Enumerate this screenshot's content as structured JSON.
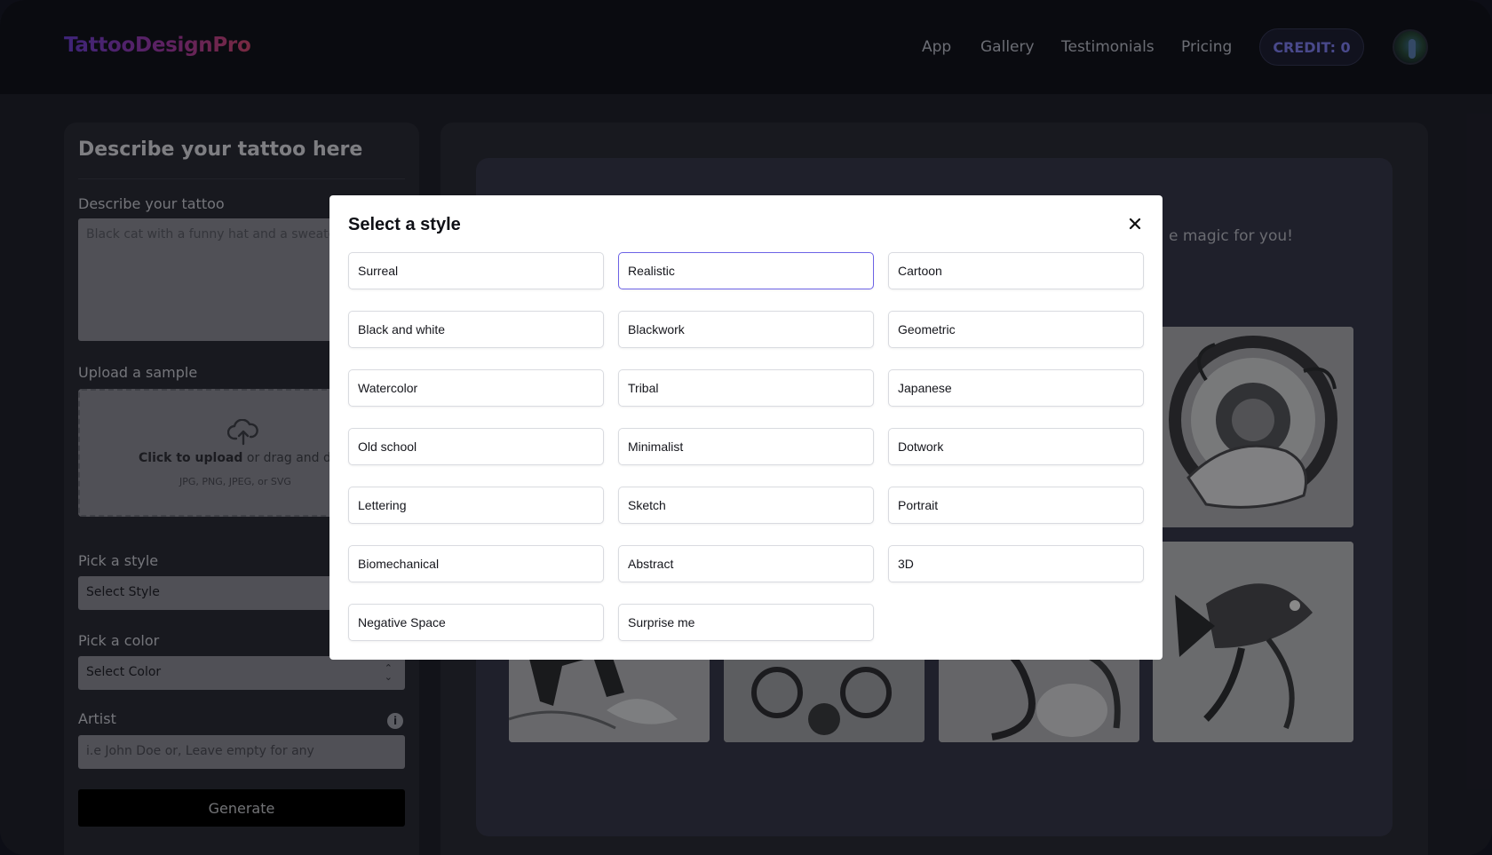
{
  "header": {
    "logo": "TattooDesignPro",
    "nav": [
      "App",
      "Gallery",
      "Testimonials",
      "Pricing"
    ],
    "credit": "CREDIT: 0"
  },
  "form": {
    "title": "Describe your tattoo here",
    "describe_label": "Describe your tattoo",
    "describe_value": "Black cat with a funny hat and a sweater",
    "upload_label": "Upload a sample",
    "upload_click": "Click to upload",
    "upload_drag": " or drag and drop",
    "upload_types": "JPG, PNG, JPEG, or SVG",
    "style_label": "Pick a style",
    "style_value": "Select Style",
    "color_label": "Pick a color",
    "color_value": "Select Color",
    "artist_label": "Artist",
    "artist_placeholder": "i.e John Doe or, Leave empty for any",
    "generate": "Generate"
  },
  "preview": {
    "message": "e magic for you!"
  },
  "modal": {
    "title": "Select a style",
    "selected": "Realistic",
    "options": [
      "Surreal",
      "Realistic",
      "Cartoon",
      "Black and white",
      "Blackwork",
      "Geometric",
      "Watercolor",
      "Tribal",
      "Japanese",
      "Old school",
      "Minimalist",
      "Dotwork",
      "Lettering",
      "Sketch",
      "Portrait",
      "Biomechanical",
      "Abstract",
      "3D",
      "Negative Space",
      "Surprise me"
    ]
  },
  "icons": {
    "upload": "cloud-upload-icon",
    "close": "close-icon",
    "info": "info-icon",
    "select_chevron": "chevron-updown-icon"
  }
}
